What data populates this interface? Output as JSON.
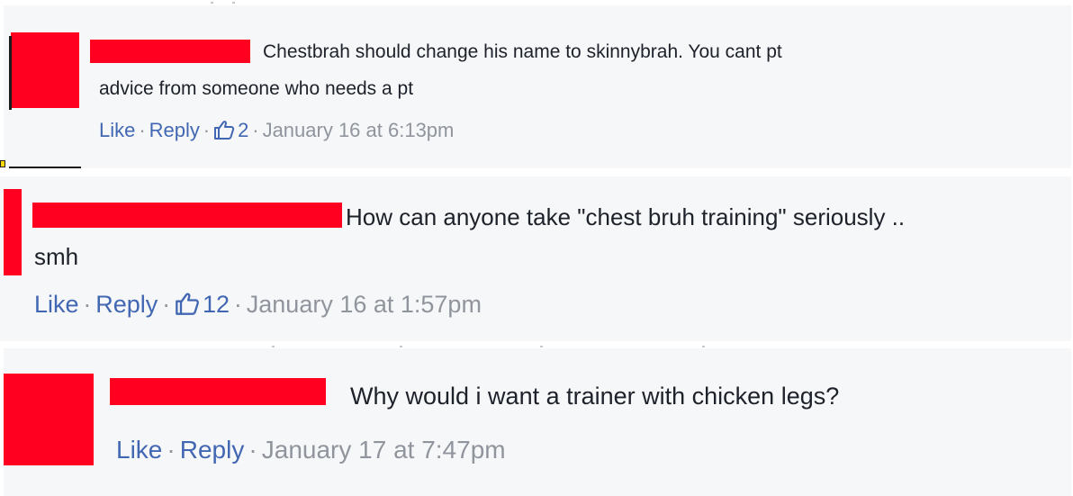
{
  "comments": [
    {
      "text_line1": "Chestbrah should change his name to skinnybrah. You cant pt",
      "text_line2": "advice from someone who needs a pt",
      "like_label": "Like",
      "reply_label": "Reply",
      "like_count": "2",
      "timestamp": "January 16 at 6:13pm",
      "separator": "·"
    },
    {
      "text_line1": "How can anyone take \"chest bruh training\" seriously ..",
      "text_line2": "smh",
      "like_label": "Like",
      "reply_label": "Reply",
      "like_count": "12",
      "timestamp": "January 16 at 1:57pm",
      "separator": "·"
    },
    {
      "text_line1": "Why would i want a trainer with chicken legs?",
      "like_label": "Like",
      "reply_label": "Reply",
      "timestamp": "January 17 at 7:47pm",
      "separator": "·"
    }
  ],
  "colors": {
    "link": "#4267b2",
    "meta": "#90949c",
    "text": "#1d2129",
    "redaction": "#ff0020",
    "panel": "#f6f7f9"
  },
  "icons": [
    "thumbs-up-icon"
  ]
}
